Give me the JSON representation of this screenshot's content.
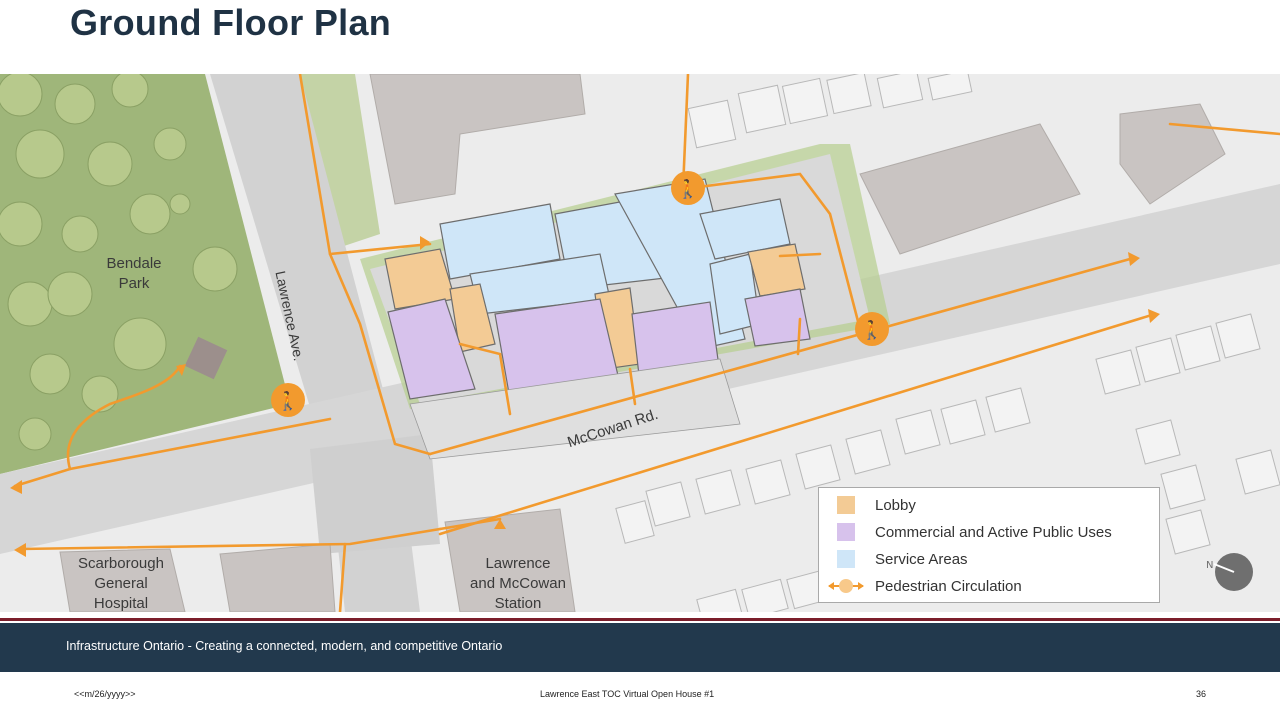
{
  "slide": {
    "title": "Ground Floor Plan"
  },
  "map": {
    "labels": {
      "park": "Bendale\nPark",
      "hospital": "Scarborough\nGeneral\nHospital",
      "station": "Lawrence\nand McCowan\nStation",
      "lawrence_ave": "Lawrence Ave.",
      "mccowan_rd": "McCowan Rd."
    },
    "colors": {
      "lobby": "#f3cb95",
      "commercial": "#d7c2ec",
      "service": "#cfe6f8",
      "pedestrian": "#f29a2e",
      "park_green": "#9fb67a"
    },
    "icons": [
      "pedestrian-icon",
      "north-arrow-icon"
    ]
  },
  "legend": {
    "items": [
      {
        "label": "Lobby",
        "color": "#f3cb95"
      },
      {
        "label": "Commercial and Active Public Uses",
        "color": "#d7c2ec"
      },
      {
        "label": "Service Areas",
        "color": "#cfe6f8"
      },
      {
        "label": "Pedestrian Circulation",
        "color": "#f29a2e"
      }
    ]
  },
  "footer": {
    "tagline": "Infrastructure Ontario - Creating a connected, modern, and competitive Ontario",
    "date": "<<m/26/yyyy>>",
    "event": "Lawrence East TOC Virtual Open House #1",
    "page": "36"
  }
}
